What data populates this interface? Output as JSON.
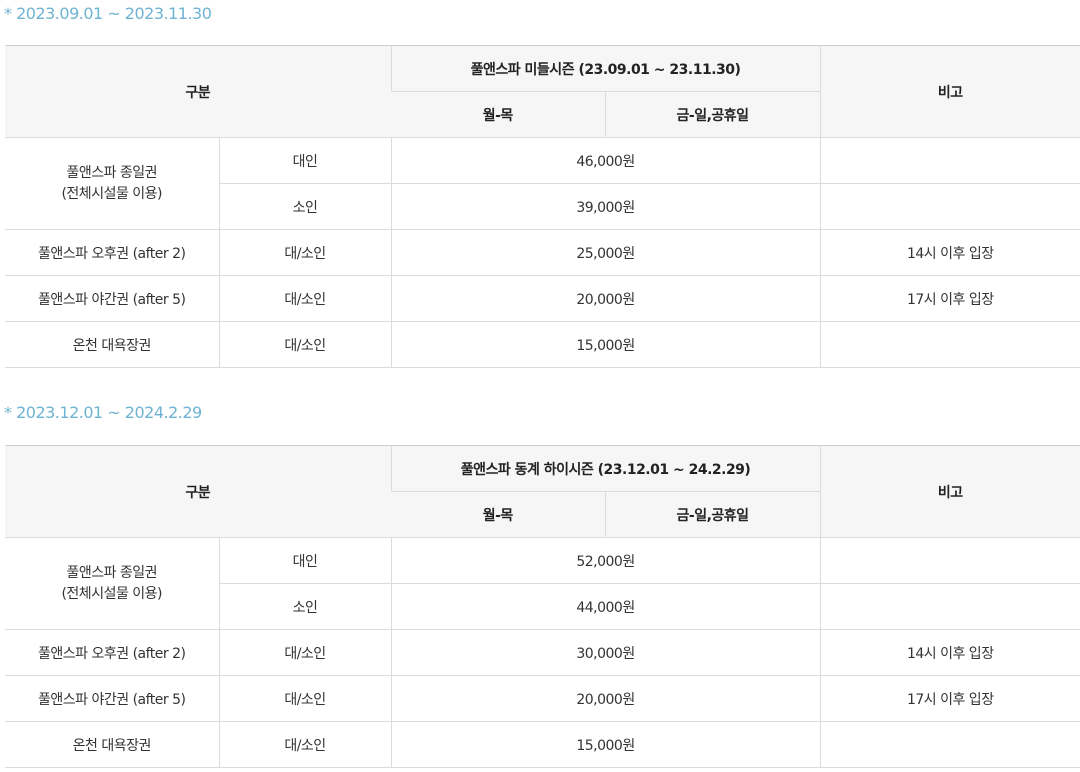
{
  "sections": [
    {
      "period": "* 2023.09.01 ~ 2023.11.30",
      "header": {
        "category": "구분",
        "season": "풀앤스파 미들시즌 (23.09.01 ~ 23.11.30)",
        "weekday": "월-목",
        "weekend": "금-일,공휴일",
        "note": "비고"
      },
      "full_day": {
        "name_line1": "풀앤스파 종일권",
        "name_line2": "(전체시설물 이용)",
        "adult_label": "대인",
        "adult_price": "46,000원",
        "child_label": "소인",
        "child_price": "39,000원"
      },
      "afternoon": {
        "name": "풀앤스파 오후권 (after 2)",
        "target": "대/소인",
        "price": "25,000원",
        "note": "14시 이후 입장"
      },
      "night": {
        "name": "풀앤스파 야간권 (after 5)",
        "target": "대/소인",
        "price": "20,000원",
        "note": "17시 이후 입장"
      },
      "bath": {
        "name": "온천 대욕장권",
        "target": "대/소인",
        "price": "15,000원",
        "note": ""
      }
    },
    {
      "period": "* 2023.12.01 ~ 2024.2.29",
      "header": {
        "category": "구분",
        "season": "풀앤스파 동계 하이시즌 (23.12.01 ~ 24.2.29)",
        "weekday": "월-목",
        "weekend": "금-일,공휴일",
        "note": "비고"
      },
      "full_day": {
        "name_line1": "풀앤스파 종일권",
        "name_line2": "(전체시설물 이용)",
        "adult_label": "대인",
        "adult_price": "52,000원",
        "child_label": "소인",
        "child_price": "44,000원"
      },
      "afternoon": {
        "name": "풀앤스파 오후권 (after 2)",
        "target": "대/소인",
        "price": "30,000원",
        "note": "14시 이후 입장"
      },
      "night": {
        "name": "풀앤스파 야간권 (after 5)",
        "target": "대/소인",
        "price": "20,000원",
        "note": "17시 이후 입장"
      },
      "bath": {
        "name": "온천 대욕장권",
        "target": "대/소인",
        "price": "15,000원",
        "note": ""
      }
    }
  ]
}
